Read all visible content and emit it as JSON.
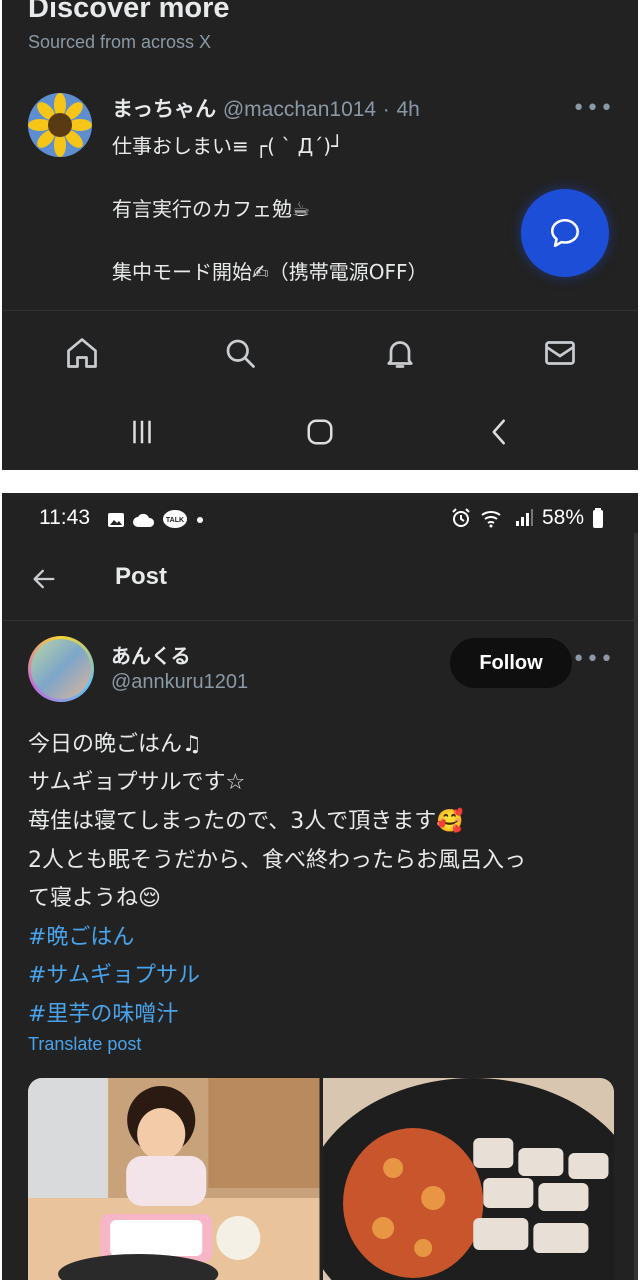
{
  "top": {
    "discover": {
      "title": "Discover more",
      "subtitle": "Sourced from across X"
    },
    "tweet": {
      "name": "まっちゃん",
      "handle": "@macchan1014",
      "sep": "·",
      "time": "4h",
      "lines": [
        "仕事おしまい≡ ┌( ˋ Д´)┘",
        "有言実行のカフェ勉☕",
        "集中モード開始✍（携帯電源OFF）"
      ]
    },
    "tabs": [
      "home-icon",
      "search-icon",
      "bell-icon",
      "mail-icon"
    ],
    "system_nav": [
      "recents-icon",
      "home-circle-icon",
      "back-chevron-icon"
    ]
  },
  "bottom": {
    "status": {
      "time": "11:43",
      "battery": "58%"
    },
    "header": {
      "title": "Post"
    },
    "tweet": {
      "name": "あんくる",
      "handle": "@annkuru1201",
      "follow_label": "Follow",
      "lines": [
        "今日の晩ごはん♫",
        "サムギョプサルです☆",
        "苺佳は寝てしまったので、3人で頂きます🥰",
        "2人とも眠そうだから、食べ終わったらお風呂入っ",
        "て寝ようね😌"
      ],
      "hashtags": [
        "#晩ごはん",
        "#サムギョプサル",
        "#里芋の味噌汁"
      ],
      "translate": "Translate post"
    }
  },
  "colors": {
    "background": "#222222",
    "accent": "#4aa3ea",
    "fab": "#1d4ed8"
  }
}
